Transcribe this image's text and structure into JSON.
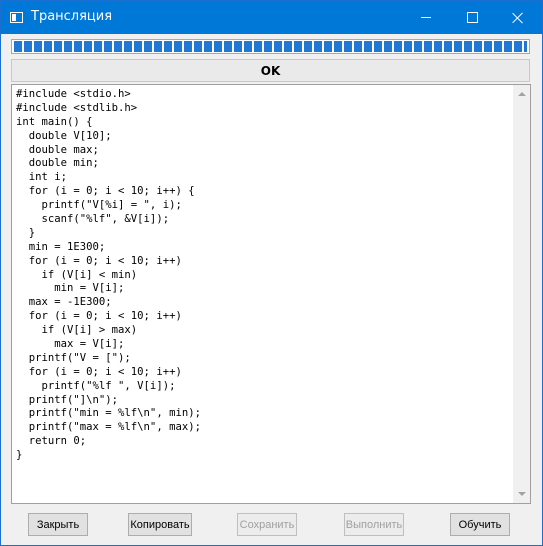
{
  "window": {
    "title": "Трансляция"
  },
  "progress": {
    "value": 1.0,
    "color": "#1e78d4"
  },
  "ok_bar": {
    "label": "OK"
  },
  "code": {
    "lines": [
      "#include <stdio.h>",
      "#include <stdlib.h>",
      "int main() {",
      "  double V[10];",
      "  double max;",
      "  double min;",
      "  int i;",
      "  for (i = 0; i < 10; i++) {",
      "    printf(\"V[%i] = \", i);",
      "    scanf(\"%lf\", &V[i]);",
      "  }",
      "  min = 1E300;",
      "  for (i = 0; i < 10; i++)",
      "    if (V[i] < min)",
      "      min = V[i];",
      "  max = -1E300;",
      "  for (i = 0; i < 10; i++)",
      "    if (V[i] > max)",
      "      max = V[i];",
      "  printf(\"V = [\");",
      "  for (i = 0; i < 10; i++)",
      "    printf(\"%lf \", V[i]);",
      "  printf(\"]\\n\");",
      "  printf(\"min = %lf\\n\", min);",
      "  printf(\"max = %lf\\n\", max);",
      "  return 0;",
      "}"
    ]
  },
  "buttons": {
    "close": "Закрыть",
    "copy": "Копировать",
    "save": "Сохранить",
    "run": "Выполнить",
    "train": "Обучить"
  },
  "colors": {
    "titlebar": "#0078d7",
    "accent": "#1e78d4"
  },
  "icons": [
    "app-icon",
    "minimize-icon",
    "maximize-icon",
    "close-icon",
    "scroll-up-arrow-icon",
    "scroll-down-arrow-icon"
  ]
}
